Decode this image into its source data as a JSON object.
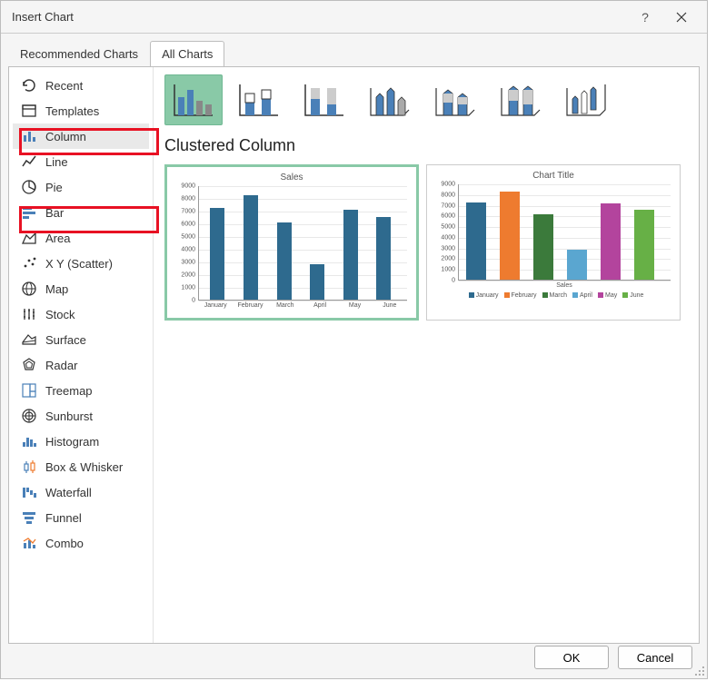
{
  "dialog": {
    "title": "Insert Chart"
  },
  "tabs": {
    "recommended": "Recommended Charts",
    "all": "All Charts"
  },
  "sidebar": {
    "items": [
      {
        "label": "Recent"
      },
      {
        "label": "Templates"
      },
      {
        "label": "Column"
      },
      {
        "label": "Line"
      },
      {
        "label": "Pie"
      },
      {
        "label": "Bar"
      },
      {
        "label": "Area"
      },
      {
        "label": "X Y (Scatter)"
      },
      {
        "label": "Map"
      },
      {
        "label": "Stock"
      },
      {
        "label": "Surface"
      },
      {
        "label": "Radar"
      },
      {
        "label": "Treemap"
      },
      {
        "label": "Sunburst"
      },
      {
        "label": "Histogram"
      },
      {
        "label": "Box & Whisker"
      },
      {
        "label": "Waterfall"
      },
      {
        "label": "Funnel"
      },
      {
        "label": "Combo"
      }
    ]
  },
  "main": {
    "charttype_title": "Clustered Column",
    "preview1": {
      "title": "Sales"
    },
    "preview2": {
      "title": "Chart Title",
      "axis_label": "Sales"
    }
  },
  "footer": {
    "ok": "OK",
    "cancel": "Cancel"
  },
  "chart_data": [
    {
      "type": "bar",
      "title": "Sales",
      "categories": [
        "January",
        "February",
        "March",
        "April",
        "May",
        "June"
      ],
      "values": [
        7200,
        8200,
        6100,
        2800,
        7100,
        6500
      ],
      "ylim": [
        0,
        9000
      ],
      "yticks": [
        0,
        1000,
        2000,
        3000,
        4000,
        5000,
        6000,
        7000,
        8000,
        9000
      ],
      "color": "#2e6a8e"
    },
    {
      "type": "bar",
      "title": "Chart Title",
      "categories": [
        "January",
        "February",
        "March",
        "April",
        "May",
        "June"
      ],
      "series": [
        {
          "name": "January",
          "value": 7200,
          "color": "#2e6a8e"
        },
        {
          "name": "February",
          "value": 8200,
          "color": "#ee7b2f"
        },
        {
          "name": "March",
          "value": 6100,
          "color": "#3b7a3b"
        },
        {
          "name": "April",
          "value": 2800,
          "color": "#5aa6d0"
        },
        {
          "name": "May",
          "value": 7100,
          "color": "#b3449d"
        },
        {
          "name": "June",
          "value": 6500,
          "color": "#67b046"
        }
      ],
      "ylim": [
        0,
        9000
      ],
      "yticks": [
        0,
        1000,
        2000,
        3000,
        4000,
        5000,
        6000,
        7000,
        8000,
        9000
      ],
      "xlabel": "Sales"
    }
  ]
}
